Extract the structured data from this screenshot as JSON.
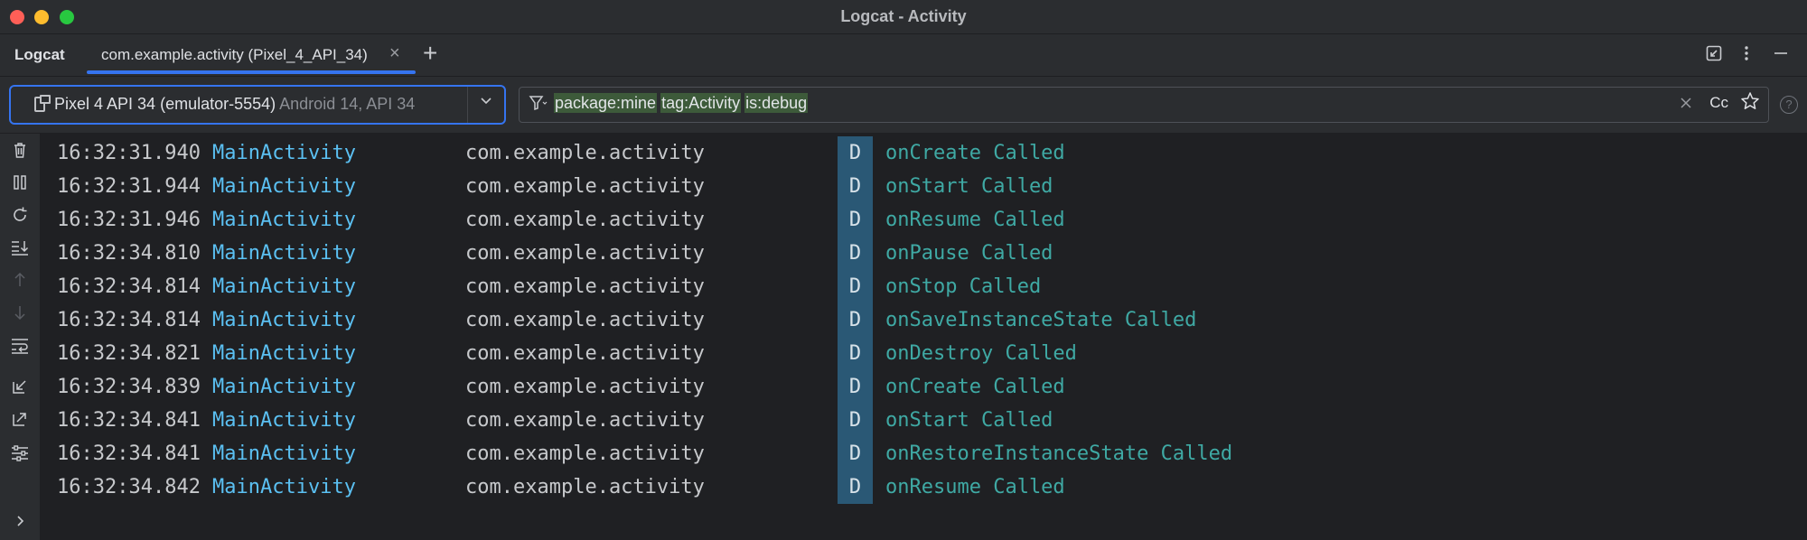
{
  "window": {
    "title": "Logcat - Activity"
  },
  "tabbar": {
    "tool_title": "Logcat",
    "active_tab": "com.example.activity (Pixel_4_API_34)",
    "close_glyph": "×",
    "add_glyph": "+",
    "icons": [
      "restore-layout-icon",
      "more-options-icon",
      "minimize-icon"
    ]
  },
  "device_selector": {
    "name": "Pixel 4 API 34 (emulator-5554)",
    "subtitle": "Android 14, API 34"
  },
  "filter": {
    "chips": [
      "package:mine",
      "tag:Activity",
      "is:debug"
    ],
    "case_label": "Cc"
  },
  "left_toolbar": {
    "icons": [
      "clear-logcat-icon",
      "pause-icon",
      "restart-icon",
      "scroll-to-end-icon",
      "previous-occurrence-icon",
      "next-occurrence-icon",
      "soft-wrap-icon",
      "import-icon",
      "export-icon",
      "logcat-format-icon",
      "expand-icon"
    ]
  },
  "log": {
    "rows": [
      {
        "time": "16:32:31.940",
        "tag": "MainActivity",
        "package": "com.example.activity",
        "level": "D",
        "message": "onCreate Called"
      },
      {
        "time": "16:32:31.944",
        "tag": "MainActivity",
        "package": "com.example.activity",
        "level": "D",
        "message": "onStart Called"
      },
      {
        "time": "16:32:31.946",
        "tag": "MainActivity",
        "package": "com.example.activity",
        "level": "D",
        "message": "onResume Called"
      },
      {
        "time": "16:32:34.810",
        "tag": "MainActivity",
        "package": "com.example.activity",
        "level": "D",
        "message": "onPause Called"
      },
      {
        "time": "16:32:34.814",
        "tag": "MainActivity",
        "package": "com.example.activity",
        "level": "D",
        "message": "onStop Called"
      },
      {
        "time": "16:32:34.814",
        "tag": "MainActivity",
        "package": "com.example.activity",
        "level": "D",
        "message": "onSaveInstanceState Called"
      },
      {
        "time": "16:32:34.821",
        "tag": "MainActivity",
        "package": "com.example.activity",
        "level": "D",
        "message": "onDestroy Called"
      },
      {
        "time": "16:32:34.839",
        "tag": "MainActivity",
        "package": "com.example.activity",
        "level": "D",
        "message": "onCreate Called"
      },
      {
        "time": "16:32:34.841",
        "tag": "MainActivity",
        "package": "com.example.activity",
        "level": "D",
        "message": "onStart Called"
      },
      {
        "time": "16:32:34.841",
        "tag": "MainActivity",
        "package": "com.example.activity",
        "level": "D",
        "message": "onRestoreInstanceState Called"
      },
      {
        "time": "16:32:34.842",
        "tag": "MainActivity",
        "package": "com.example.activity",
        "level": "D",
        "message": "onResume Called"
      }
    ]
  },
  "colors": {
    "accent": "#3574f0",
    "tag": "#5bc0f2",
    "message": "#3fa9a4",
    "debug_level_bg": "#2a5875",
    "filter_chip_bg": "#3d5a3a"
  }
}
